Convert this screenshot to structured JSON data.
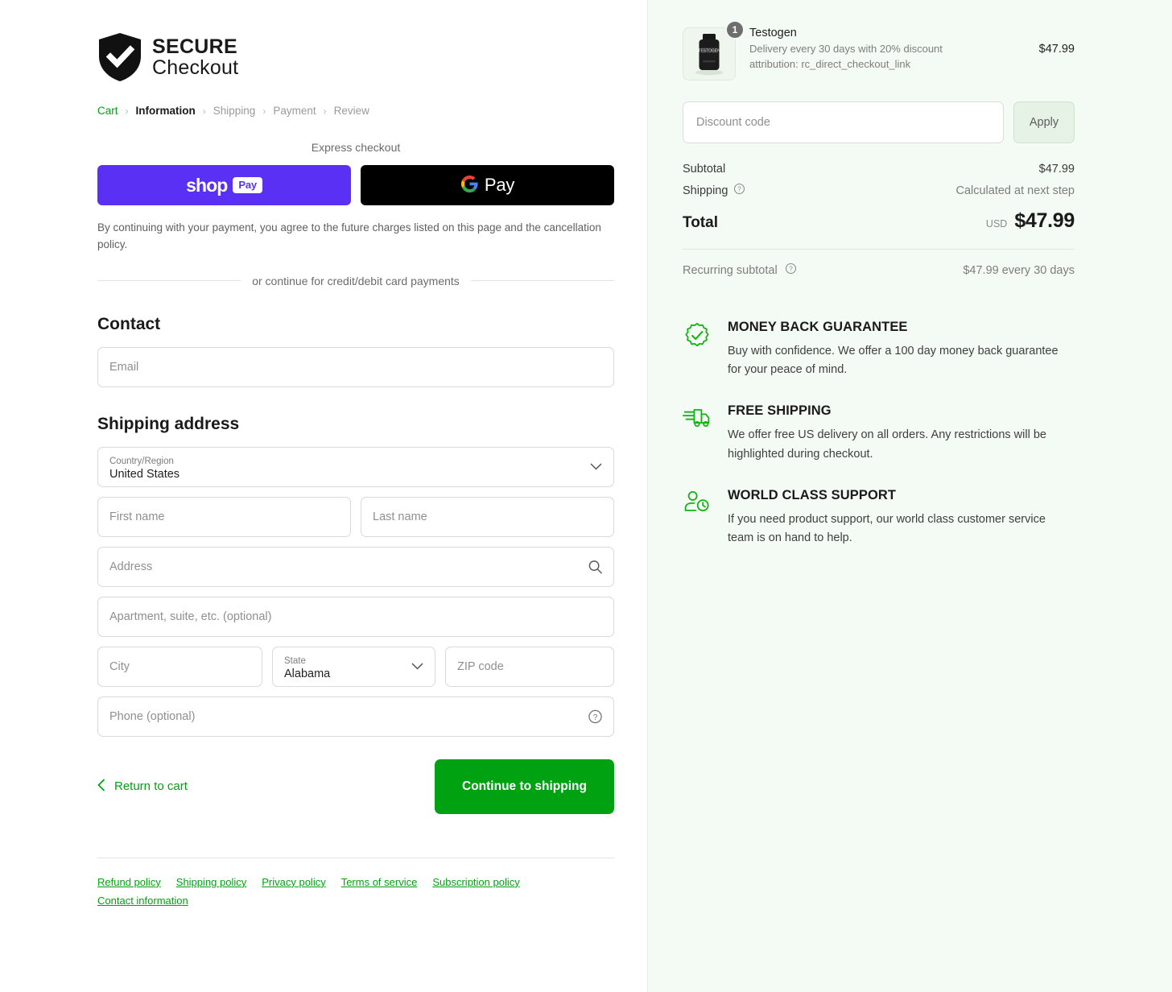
{
  "brand": {
    "logo_line1": "SECURE",
    "logo_line2": "Checkout",
    "accent_green": "#00a211",
    "shop_pay_purple": "#5a31f4",
    "panel_bg": "#f4faf4"
  },
  "breadcrumb": {
    "items": [
      {
        "label": "Cart",
        "state": "link"
      },
      {
        "label": "Information",
        "state": "current"
      },
      {
        "label": "Shipping",
        "state": "muted"
      },
      {
        "label": "Payment",
        "state": "muted"
      },
      {
        "label": "Review",
        "state": "muted"
      }
    ],
    "separator": "›"
  },
  "express": {
    "title": "Express checkout",
    "shop_pay": {
      "word": "shop",
      "chip": "Pay"
    },
    "google_pay": {
      "word": "Pay",
      "icon": "google-g-icon"
    },
    "legal": "By continuing with your payment, you agree to the future charges listed on this page and the cancellation policy.",
    "divider_text": "or continue for credit/debit card payments"
  },
  "contact": {
    "title": "Contact",
    "email_placeholder": "Email"
  },
  "shipping_address": {
    "title": "Shipping address",
    "country": {
      "label": "Country/Region",
      "value": "United States"
    },
    "first_name_placeholder": "First name",
    "last_name_placeholder": "Last name",
    "address_placeholder": "Address",
    "apartment_placeholder": "Apartment, suite, etc. (optional)",
    "city_placeholder": "City",
    "state": {
      "label": "State",
      "value": "Alabama"
    },
    "zip_placeholder": "ZIP code",
    "phone_placeholder": "Phone (optional)"
  },
  "actions": {
    "return_label": "Return to cart",
    "continue_label": "Continue to shipping"
  },
  "footer": {
    "links": [
      "Refund policy",
      "Shipping policy",
      "Privacy policy",
      "Terms of service",
      "Subscription policy",
      "Contact information"
    ]
  },
  "order": {
    "product": {
      "name": "Testogen",
      "subtitle_line1": "Delivery every 30 days with 20% discount",
      "subtitle_line2": "attribution: rc_direct_checkout_link",
      "quantity": "1",
      "price": "$47.99",
      "thumb_label": "TESTOGEN"
    },
    "discount": {
      "placeholder": "Discount code",
      "apply_label": "Apply"
    },
    "subtotal": {
      "label": "Subtotal",
      "value": "$47.99"
    },
    "shipping": {
      "label": "Shipping",
      "value": "Calculated at next step"
    },
    "total": {
      "label": "Total",
      "currency": "USD",
      "value": "$47.99"
    },
    "recurring": {
      "label": "Recurring subtotal",
      "value": "$47.99 every 30 days"
    }
  },
  "badges": [
    {
      "icon": "badge-check-icon",
      "title": "MONEY BACK GUARANTEE",
      "body": "Buy with confidence. We offer a 100 day money back guarantee for your peace of mind."
    },
    {
      "icon": "delivery-truck-icon",
      "title": "FREE SHIPPING",
      "body": "We offer free US delivery on all orders. Any restrictions will be highlighted during checkout."
    },
    {
      "icon": "support-person-clock-icon",
      "title": "WORLD CLASS SUPPORT",
      "body": "If you need product support, our world class customer service team is on hand to help."
    }
  ]
}
